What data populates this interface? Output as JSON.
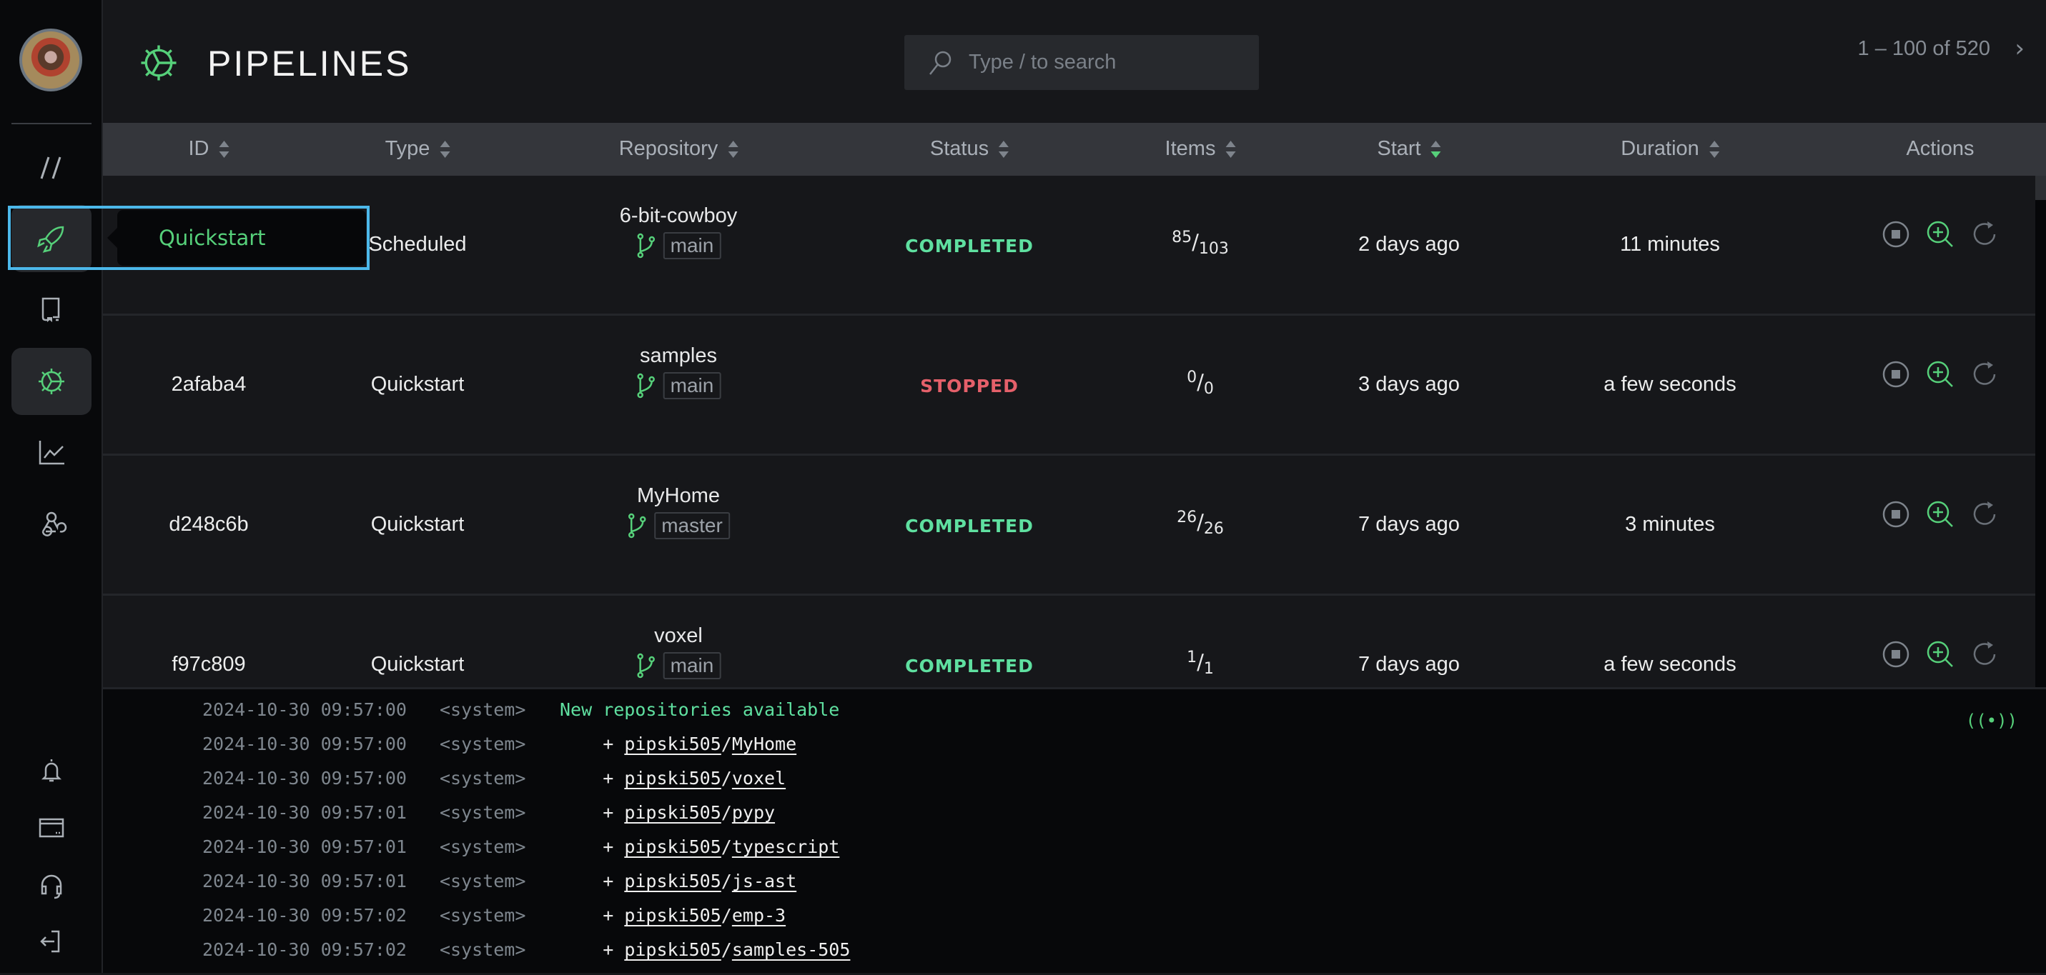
{
  "sidebar": {
    "avatar_alt": "user avatar",
    "nav": [
      {
        "icon": "slashes-icon",
        "label": ""
      },
      {
        "icon": "rocket-icon",
        "label": "Quickstart"
      },
      {
        "icon": "book-icon",
        "label": ""
      },
      {
        "icon": "pipelines-gear-icon",
        "label": "",
        "active": true
      },
      {
        "icon": "chart-icon",
        "label": ""
      },
      {
        "icon": "webhook-icon",
        "label": ""
      }
    ],
    "bottom": [
      "bell-icon",
      "billing-icon",
      "headset-icon",
      "logout-icon"
    ],
    "tooltip": "Quickstart"
  },
  "header": {
    "title": "PIPELINES",
    "search_placeholder": "Type / to search",
    "pagination": "1 – 100 of 520"
  },
  "table": {
    "columns": [
      "ID",
      "Type",
      "Repository",
      "Status",
      "Items",
      "Start",
      "Duration",
      "Actions"
    ],
    "sorted_column": "Start",
    "sort_direction": "descending",
    "rows": [
      {
        "id": "",
        "type": "Scheduled",
        "repo": "6-bit-cowboy",
        "branch": "main",
        "status": "COMPLETED",
        "items_done": "85",
        "items_total": "103",
        "start": "2 days ago",
        "duration": "11 minutes"
      },
      {
        "id": "2afaba4",
        "type": "Quickstart",
        "repo": "samples",
        "branch": "main",
        "status": "STOPPED",
        "items_done": "0",
        "items_total": "0",
        "start": "3 days ago",
        "duration": "a few seconds"
      },
      {
        "id": "d248c6b",
        "type": "Quickstart",
        "repo": "MyHome",
        "branch": "master",
        "status": "COMPLETED",
        "items_done": "26",
        "items_total": "26",
        "start": "7 days ago",
        "duration": "3 minutes"
      },
      {
        "id": "f97c809",
        "type": "Quickstart",
        "repo": "voxel",
        "branch": "main",
        "status": "COMPLETED",
        "items_done": "1",
        "items_total": "1",
        "start": "7 days ago",
        "duration": "a few seconds"
      }
    ]
  },
  "log": {
    "live_indicator": "((•))",
    "lines": [
      {
        "ts": "2024-10-30 09:57:00",
        "src": "<system>",
        "msg": "New repositories available"
      },
      {
        "ts": "2024-10-30 09:57:00",
        "src": "<system>",
        "owner": "pipski505",
        "repo": "MyHome"
      },
      {
        "ts": "2024-10-30 09:57:00",
        "src": "<system>",
        "owner": "pipski505",
        "repo": "voxel"
      },
      {
        "ts": "2024-10-30 09:57:01",
        "src": "<system>",
        "owner": "pipski505",
        "repo": "pypy"
      },
      {
        "ts": "2024-10-30 09:57:01",
        "src": "<system>",
        "owner": "pipski505",
        "repo": "typescript"
      },
      {
        "ts": "2024-10-30 09:57:01",
        "src": "<system>",
        "owner": "pipski505",
        "repo": "js-ast"
      },
      {
        "ts": "2024-10-30 09:57:02",
        "src": "<system>",
        "owner": "pipski505",
        "repo": "emp-3"
      },
      {
        "ts": "2024-10-30 09:57:02",
        "src": "<system>",
        "owner": "pipski505",
        "repo": "samples-505"
      }
    ]
  },
  "colors": {
    "accent": "#56d07a",
    "completed": "#5fe0a0",
    "stopped": "#e5606a",
    "highlight": "#4cb8ea"
  }
}
